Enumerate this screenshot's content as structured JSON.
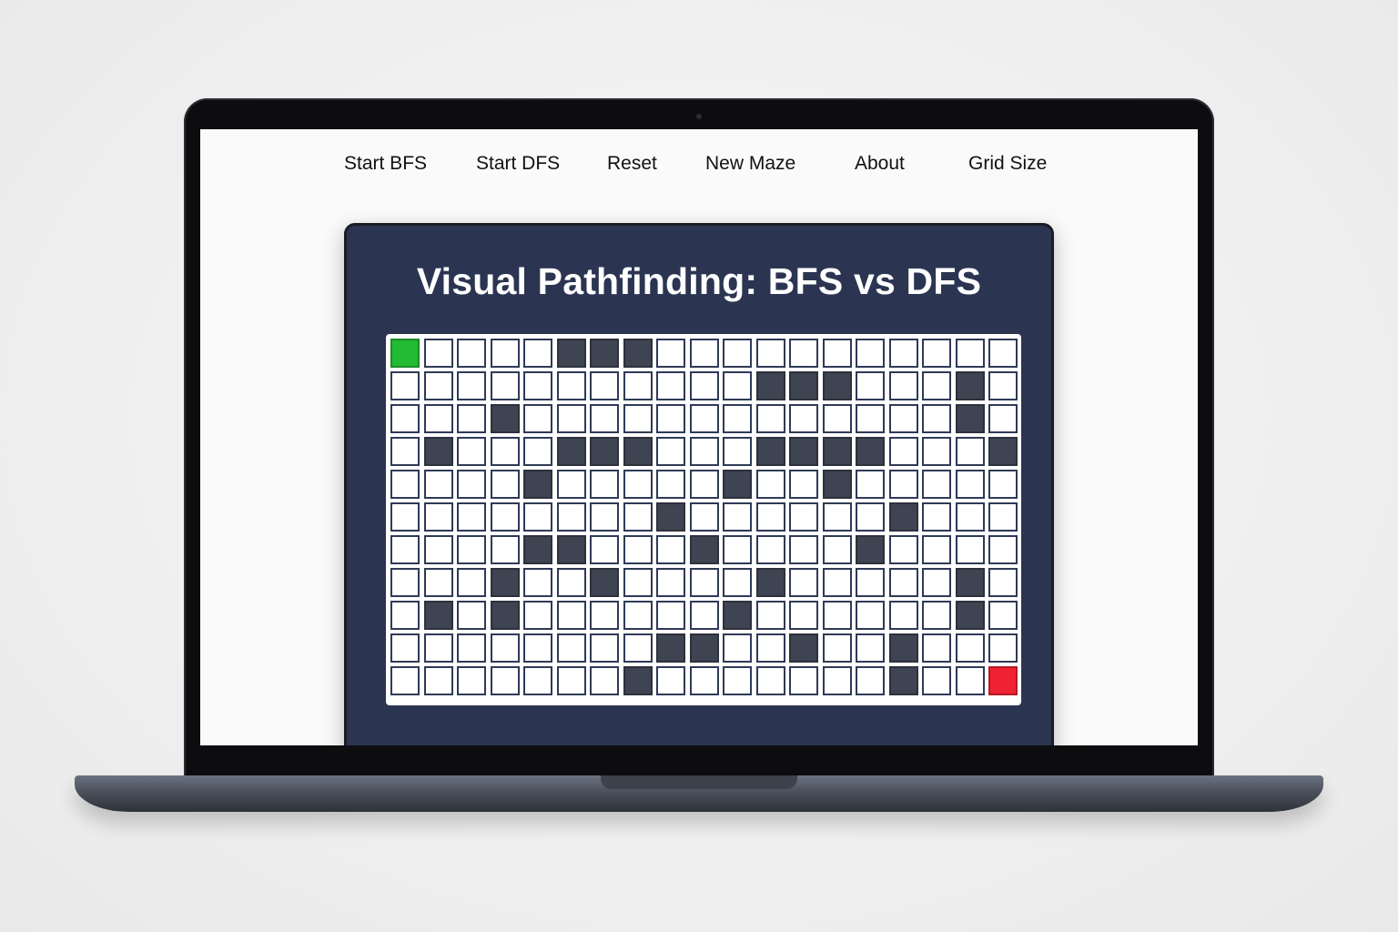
{
  "nav": {
    "items": [
      {
        "label": "Start BFS"
      },
      {
        "label": "Start DFS"
      },
      {
        "label": "Reset"
      },
      {
        "label": "New Maze"
      },
      {
        "label": "About"
      },
      {
        "label": "Grid Size"
      }
    ]
  },
  "app": {
    "title": "Visual Pathfinding: BFS vs DFS"
  },
  "grid": {
    "rows": 11,
    "cols": 19,
    "start": [
      0,
      0
    ],
    "end": [
      10,
      18
    ],
    "walls": [
      [
        0,
        5
      ],
      [
        0,
        6
      ],
      [
        0,
        7
      ],
      [
        1,
        11
      ],
      [
        1,
        12
      ],
      [
        1,
        13
      ],
      [
        1,
        17
      ],
      [
        2,
        3
      ],
      [
        2,
        17
      ],
      [
        3,
        1
      ],
      [
        3,
        5
      ],
      [
        3,
        6
      ],
      [
        3,
        7
      ],
      [
        3,
        11
      ],
      [
        3,
        12
      ],
      [
        3,
        13
      ],
      [
        3,
        14
      ],
      [
        3,
        18
      ],
      [
        4,
        4
      ],
      [
        4,
        10
      ],
      [
        4,
        13
      ],
      [
        5,
        8
      ],
      [
        5,
        15
      ],
      [
        6,
        4
      ],
      [
        6,
        5
      ],
      [
        6,
        9
      ],
      [
        6,
        14
      ],
      [
        7,
        3
      ],
      [
        7,
        6
      ],
      [
        7,
        11
      ],
      [
        7,
        17
      ],
      [
        8,
        1
      ],
      [
        8,
        3
      ],
      [
        8,
        10
      ],
      [
        8,
        17
      ],
      [
        9,
        8
      ],
      [
        9,
        9
      ],
      [
        9,
        12
      ],
      [
        9,
        15
      ],
      [
        10,
        7
      ],
      [
        10,
        15
      ]
    ],
    "colors": {
      "empty": "#ffffff",
      "wall": "#3f4452",
      "start": "#22bb33",
      "end": "#ee2233",
      "panel": "#2b3552"
    }
  }
}
